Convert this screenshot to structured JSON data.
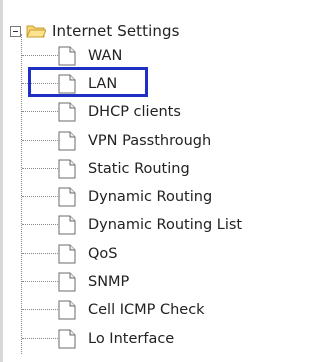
{
  "tree": {
    "root": {
      "label": "Internet Settings",
      "expanded": true
    },
    "items": [
      {
        "label": "WAN",
        "selected": false
      },
      {
        "label": "LAN",
        "selected": true
      },
      {
        "label": "DHCP clients",
        "selected": false
      },
      {
        "label": "VPN Passthrough",
        "selected": false
      },
      {
        "label": "Static Routing",
        "selected": false
      },
      {
        "label": "Dynamic Routing",
        "selected": false
      },
      {
        "label": "Dynamic Routing List",
        "selected": false
      },
      {
        "label": "QoS",
        "selected": false
      },
      {
        "label": "SNMP",
        "selected": false
      },
      {
        "label": "Cell ICMP Check",
        "selected": false
      },
      {
        "label": "Lo Interface",
        "selected": false
      }
    ]
  },
  "colors": {
    "selection_border": "#1e2fc6",
    "text": "#222222",
    "folder": "#f2c94c",
    "connector": "#8a8a8a"
  }
}
